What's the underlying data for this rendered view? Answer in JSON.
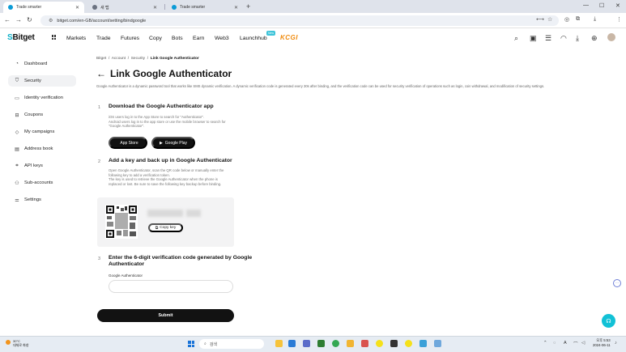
{
  "browser": {
    "tabs": [
      {
        "label": "Trade smarter",
        "active": true
      },
      {
        "label": "새 탭",
        "active": false
      },
      {
        "label": "Trade smarter",
        "active": false
      }
    ],
    "url": "bitget.com/en-GB/account/setting/bindgoogle"
  },
  "site": {
    "logo": "Bitget",
    "nav": [
      "Markets",
      "Trade",
      "Futures",
      "Copy",
      "Bots",
      "Earn",
      "Web3",
      "Launchhub"
    ],
    "new_badge": "New",
    "promo_logo": "KCGI"
  },
  "sidebar": {
    "items": [
      {
        "label": "Dashboard",
        "icon": "dashboard-icon",
        "active": false
      },
      {
        "label": "Security",
        "icon": "shield-icon",
        "active": true
      },
      {
        "label": "Identity verification",
        "icon": "id-card-icon",
        "active": false
      },
      {
        "label": "Coupons",
        "icon": "coupon-icon",
        "active": false
      },
      {
        "label": "My campaigns",
        "icon": "diamond-icon",
        "active": false
      },
      {
        "label": "Address book",
        "icon": "address-book-icon",
        "active": false
      },
      {
        "label": "API keys",
        "icon": "api-icon",
        "active": false
      },
      {
        "label": "Sub-accounts",
        "icon": "sub-accounts-icon",
        "active": false
      },
      {
        "label": "Settings",
        "icon": "settings-icon",
        "active": false
      }
    ]
  },
  "breadcrumb": {
    "items": [
      "Bitget",
      "Account",
      "Security"
    ],
    "current": "Link Google Authenticator"
  },
  "page": {
    "title": "Link Google Authenticator",
    "description": "Google Authenticator is a dynamic password tool that works like SMS dynamic verification. A dynamic verification code is generated every 30s after binding, and the verification code can be used for security verification of operations such as login, coin withdrawal, and modification of security settings."
  },
  "steps": [
    {
      "num": "1",
      "title": "Download the Google Authenticator app",
      "desc_lines": [
        "iOS users log in to the App Store to search for \"Authenticator\".",
        "Android users log in to the app store or use the mobile browser to search for",
        "\"Google Authenticator\"."
      ],
      "buttons": [
        "App Store",
        "Google Play"
      ]
    },
    {
      "num": "2",
      "title": "Add a key and back up in Google Authenticator",
      "desc_lines": [
        "Open Google Authenticator, scan the QR code below or manually enter the",
        "following key to add a verification token.",
        "The key is used to retrieve the Google Authenticator when the phone is",
        "replaced or lost. Be sure to save the following key backup before binding."
      ],
      "copy_label": "Copy key"
    },
    {
      "num": "3",
      "title_lines": [
        "Enter the 6-digit verification code generated by Google",
        "Authenticator"
      ],
      "field_label": "Google Authenticator",
      "field_value": ""
    }
  ],
  "submit_label": "Submit",
  "taskbar": {
    "weather_temp": "30°C",
    "weather_desc": "대체로 화창",
    "search_placeholder": "검색",
    "time": "오후 5:53",
    "date": "2024-06-11"
  },
  "colors": {
    "brand": "#0fb1c9",
    "primary_button": "#121212",
    "promo": "#f08a0c",
    "chat": "#12c1d6"
  }
}
